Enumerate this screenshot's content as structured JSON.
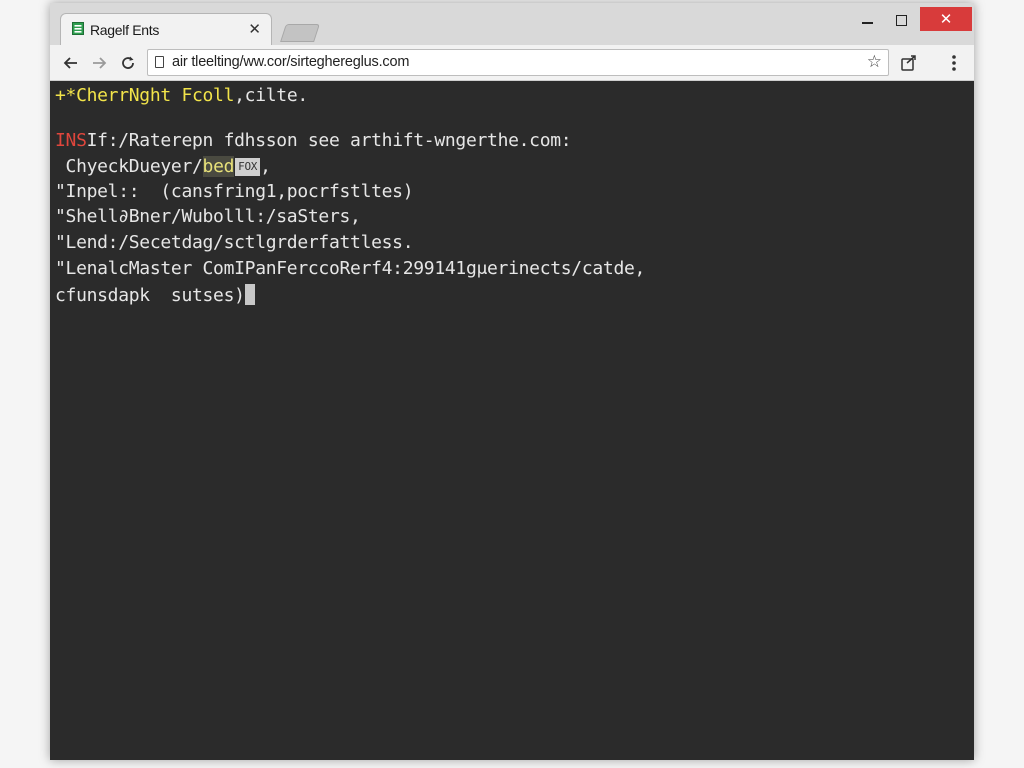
{
  "tab": {
    "title": "Ragelf Ents",
    "close_glyph": "✕",
    "favicon": "sheet-icon"
  },
  "window_controls": {
    "close_glyph": "✕"
  },
  "toolbar": {
    "back_icon": "arrow-left-icon",
    "forward_icon": "arrow-right-icon",
    "reload_icon": "reload-icon",
    "url": "air tleelting/ww.cor/sirteghereglus.com",
    "star_glyph": "☆",
    "extension_icon": "extension-icon",
    "menu_icon": "kebab-menu-icon"
  },
  "terminal": {
    "line1_prefix": "+*CherrNght Fcoll",
    "line1_suffix": ",cilte.",
    "line2_prefix": "INS",
    "line2_rest": "If:/Raterepn fdhsson see arthift-wngerthe.com:",
    "line3_pre": " ChyeckDueyer/",
    "line3_highlight": "bed",
    "line3_tag": "FOX",
    "line3_post": ",",
    "line4": "\"Inpel::  (cansfring1,pocrfstltes)",
    "line5": "\"Shell∂Bner/Wubolll:/saSters,",
    "line6": "\"Lend:/Secetdag/sctlgrderfattless.",
    "line7": "\"LenalcMaster ComIPanFercсoRerf4:299141gμerinects/catde,",
    "line8": "cfunsdapk  sutses)"
  },
  "colors": {
    "terminal_bg": "#2b2b2b",
    "terminal_text": "#e6e6e6",
    "accent_yellow": "#f2e44a",
    "accent_red": "#e0463c",
    "close_button": "#d83b3b"
  }
}
